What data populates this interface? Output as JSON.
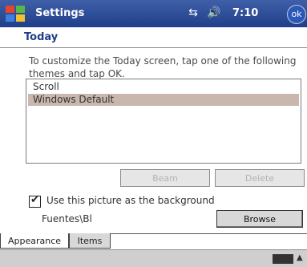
{
  "titlebar": {
    "app_title": "Settings",
    "clock": "7:10",
    "ok_label": "ok"
  },
  "header": {
    "title": "Today"
  },
  "content": {
    "instructions": "To customize the Today screen, tap one of the following themes and tap OK.",
    "themes": [
      {
        "label": "Scroll",
        "selected": false
      },
      {
        "label": "Windows Default",
        "selected": true
      }
    ],
    "buttons": {
      "beam_label": "Beam",
      "delete_label": "Delete",
      "browse_label": "Browse"
    },
    "checkbox": {
      "checked": true,
      "label": "Use this picture as the background"
    },
    "file_name": "Fuentes\\Bl"
  },
  "tabs": [
    {
      "label": "Appearance",
      "active": true
    },
    {
      "label": "Items",
      "active": false
    }
  ],
  "colors": {
    "titlebar": "#2d4f9b",
    "selection": "#c9b7ad",
    "header_text": "#1f3f8a"
  }
}
